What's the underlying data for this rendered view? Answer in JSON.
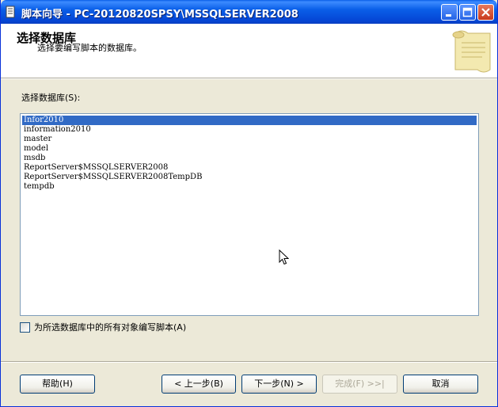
{
  "window": {
    "title": "脚本向导 - PC-20120820SPSY\\MSSQLSERVER2008"
  },
  "header": {
    "title": "选择数据库",
    "subtitle": "选择要编写脚本的数据库。"
  },
  "database_list": {
    "label": "选择数据库(S):",
    "items": [
      "Infor2010",
      "information2010",
      "master",
      "model",
      "msdb",
      "ReportServer$MSSQLSERVER2008",
      "ReportServer$MSSQLSERVER2008TempDB",
      "tempdb"
    ],
    "selected_index": 0
  },
  "options": {
    "script_all_objects_label": "为所选数据库中的所有对象编写脚本(A)",
    "script_all_objects_checked": false
  },
  "buttons": {
    "help": "帮助(H)",
    "back": "< 上一步(B)",
    "next": "下一步(N) >",
    "finish": "完成(F) >>|",
    "cancel": "取消"
  },
  "colors": {
    "titlebar": "#0a5fe8",
    "selection": "#316ac5",
    "dialog_bg": "#ece9d8"
  }
}
